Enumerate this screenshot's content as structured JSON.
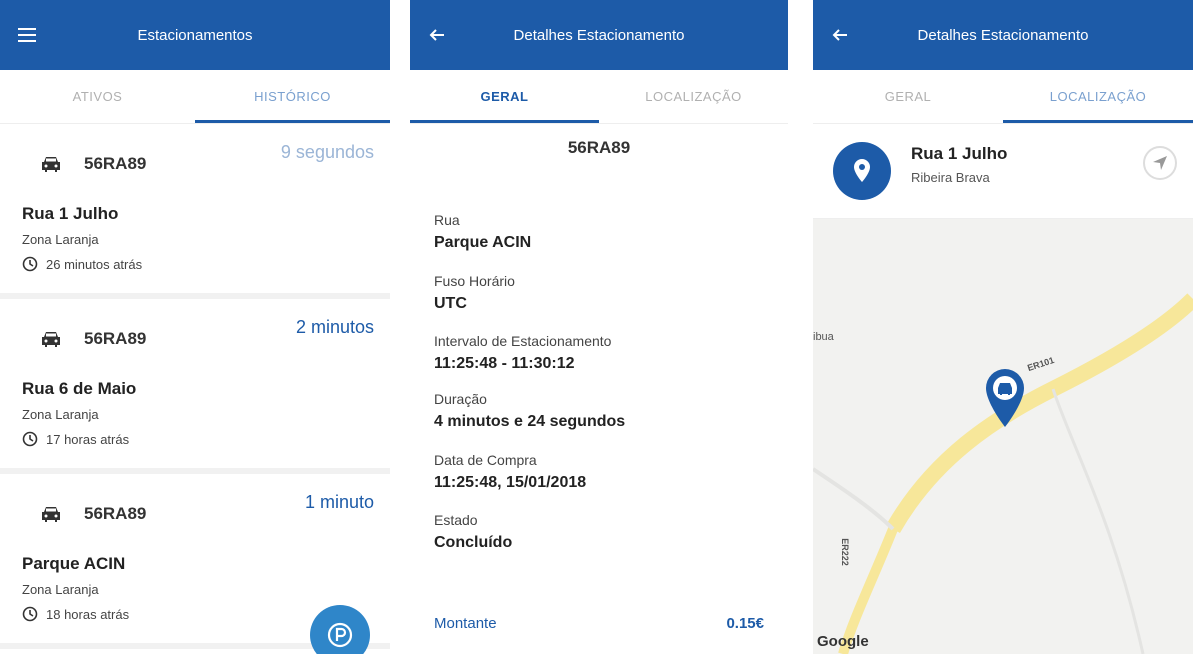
{
  "screen1": {
    "title": "Estacionamentos",
    "tabs": [
      "ATIVOS",
      "HISTÓRICO"
    ],
    "items": [
      {
        "plate": "56RA89",
        "time": "9 segundos",
        "street": "Rua 1 Julho",
        "zone": "Zona Laranja",
        "ago": "26 minutos atrás"
      },
      {
        "plate": "56RA89",
        "time": "2 minutos",
        "street": "Rua 6 de Maio",
        "zone": "Zona Laranja",
        "ago": "17 horas atrás"
      },
      {
        "plate": "56RA89",
        "time": "1 minuto",
        "street": "Parque ACIN",
        "zone": "Zona Laranja",
        "ago": "18 horas atrás"
      }
    ],
    "fab_icon": "parking-icon"
  },
  "screen2": {
    "title": "Detalhes Estacionamento",
    "tabs": [
      "GERAL",
      "LOCALIZAÇÃO"
    ],
    "plate": "56RA89",
    "details": [
      {
        "label": "Rua",
        "value": "Parque ACIN"
      },
      {
        "label": "Fuso Horário",
        "value": "UTC"
      },
      {
        "label": "Intervalo de Estacionamento",
        "value": "11:25:48 - 11:30:12"
      },
      {
        "label": "Duração",
        "value": "4 minutos e 24 segundos"
      },
      {
        "label": "Data de Compra",
        "value": "11:25:48, 15/01/2018"
      },
      {
        "label": "Estado",
        "value": "Concluído"
      }
    ],
    "amount_label": "Montante",
    "amount_value": "0.15€"
  },
  "screen3": {
    "title": "Detalhes Estacionamento",
    "tabs": [
      "GERAL",
      "LOCALIZAÇÃO"
    ],
    "street": "Rua 1 Julho",
    "city": "Ribeira Brava",
    "map_labels": {
      "road1": "ER101",
      "road2": "ER222",
      "place": "ibua"
    },
    "google": "Google"
  },
  "colors": {
    "primary": "#1d5ba8",
    "fab": "#2f86c9",
    "road": "#f7e79a"
  }
}
